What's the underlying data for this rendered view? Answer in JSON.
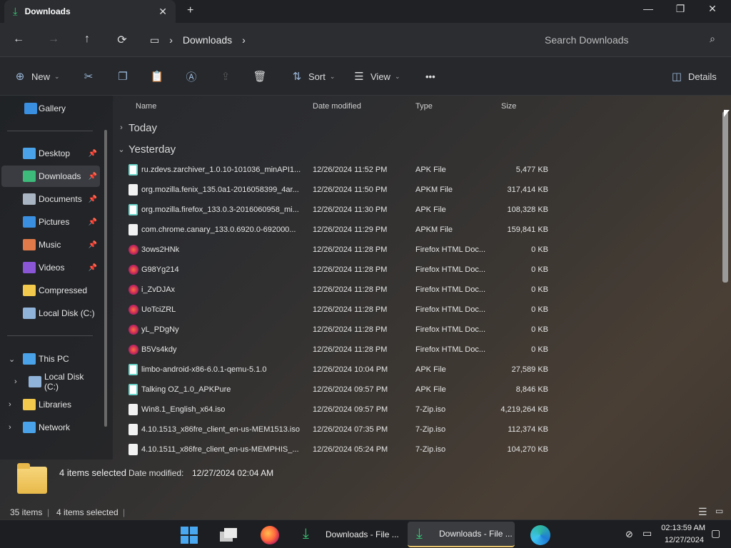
{
  "window": {
    "tab_title": "Downloads",
    "tab_close": "✕",
    "new_tab": "+",
    "controls": {
      "minimize": "—",
      "maximize": "❐",
      "close": "✕"
    }
  },
  "address": {
    "back": "←",
    "forward": "→",
    "up": "↑",
    "refresh": "⟳",
    "crumbs": [
      "Downloads"
    ],
    "search_placeholder": "Search Downloads"
  },
  "toolbar": {
    "new": "New",
    "sort": "Sort",
    "view": "View",
    "more": "•••",
    "details": "Details"
  },
  "sidebar": {
    "gallery": "Gallery",
    "quick": [
      {
        "label": "Desktop",
        "color": "#4aa3e8",
        "pinned": true
      },
      {
        "label": "Downloads",
        "color": "#3dbb7a",
        "pinned": true,
        "selected": true
      },
      {
        "label": "Documents",
        "color": "#a9b4c2",
        "pinned": true
      },
      {
        "label": "Pictures",
        "color": "#3a8fe0",
        "pinned": true
      },
      {
        "label": "Music",
        "color": "#e07a4a",
        "pinned": true
      },
      {
        "label": "Videos",
        "color": "#8b56d6",
        "pinned": true
      },
      {
        "label": "Compressed",
        "color": "#f2c94c",
        "pinned": false
      },
      {
        "label": "Local Disk (C:)",
        "color": "#8fb3d9",
        "pinned": false
      }
    ],
    "tree": [
      {
        "label": "This PC",
        "chev": "⌄"
      },
      {
        "label": "Local Disk (C:)",
        "chev": "›"
      },
      {
        "label": "Libraries",
        "chev": "›"
      },
      {
        "label": "Network",
        "chev": "›"
      }
    ]
  },
  "columns": {
    "name": "Name",
    "date": "Date modified",
    "type": "Type",
    "size": "Size"
  },
  "groups": {
    "today": "Today",
    "yesterday": "Yesterday"
  },
  "files": [
    {
      "name": "ru.zdevs.zarchiver_1.0.10-101036_minAPI1...",
      "date": "12/26/2024 11:52 PM",
      "type": "APK File",
      "size": "5,477 KB",
      "icon": "apk"
    },
    {
      "name": "org.mozilla.fenix_135.0a1-2016058399_4ar...",
      "date": "12/26/2024 11:50 PM",
      "type": "APKM File",
      "size": "317,414 KB",
      "icon": "doc"
    },
    {
      "name": "org.mozilla.firefox_133.0.3-2016060958_mi...",
      "date": "12/26/2024 11:30 PM",
      "type": "APK File",
      "size": "108,328 KB",
      "icon": "apk"
    },
    {
      "name": "com.chrome.canary_133.0.6920.0-692000...",
      "date": "12/26/2024 11:29 PM",
      "type": "APKM File",
      "size": "159,841 KB",
      "icon": "doc"
    },
    {
      "name": "3ows2HNk",
      "date": "12/26/2024 11:28 PM",
      "type": "Firefox HTML Doc...",
      "size": "0 KB",
      "icon": "ff"
    },
    {
      "name": "G98Yg214",
      "date": "12/26/2024 11:28 PM",
      "type": "Firefox HTML Doc...",
      "size": "0 KB",
      "icon": "ff"
    },
    {
      "name": "i_ZvDJAx",
      "date": "12/26/2024 11:28 PM",
      "type": "Firefox HTML Doc...",
      "size": "0 KB",
      "icon": "ff"
    },
    {
      "name": "UoTciZRL",
      "date": "12/26/2024 11:28 PM",
      "type": "Firefox HTML Doc...",
      "size": "0 KB",
      "icon": "ff"
    },
    {
      "name": "yL_PDgNy",
      "date": "12/26/2024 11:28 PM",
      "type": "Firefox HTML Doc...",
      "size": "0 KB",
      "icon": "ff"
    },
    {
      "name": "B5Vs4kdy",
      "date": "12/26/2024 11:28 PM",
      "type": "Firefox HTML Doc...",
      "size": "0 KB",
      "icon": "ff"
    },
    {
      "name": "limbo-android-x86-6.0.1-qemu-5.1.0",
      "date": "12/26/2024 10:04 PM",
      "type": "APK File",
      "size": "27,589 KB",
      "icon": "apk"
    },
    {
      "name": "Talking OZ_1.0_APKPure",
      "date": "12/26/2024 09:57 PM",
      "type": "APK File",
      "size": "8,846 KB",
      "icon": "apk"
    },
    {
      "name": "Win8.1_English_x64.iso",
      "date": "12/26/2024 09:57 PM",
      "type": "7-Zip.iso",
      "size": "4,219,264 KB",
      "icon": "doc"
    },
    {
      "name": "4.10.1513_x86fre_client_en-us-MEM1513.iso",
      "date": "12/26/2024 07:35 PM",
      "type": "7-Zip.iso",
      "size": "112,374 KB",
      "icon": "doc"
    },
    {
      "name": "4.10.1511_x86fre_client_en-us-MEMPHIS_...",
      "date": "12/26/2024 05:24 PM",
      "type": "7-Zip.iso",
      "size": "104,270 KB",
      "icon": "doc"
    }
  ],
  "details_pane": {
    "selection": "4 items selected",
    "date_label": "Date modified:",
    "date_value": "12/27/2024 02:04 AM"
  },
  "status": {
    "items": "35 items",
    "selected": "4 items selected"
  },
  "taskbar": {
    "apps": [
      {
        "label": "Downloads - File ...",
        "active": false
      },
      {
        "label": "Downloads - File ...",
        "active": true
      }
    ],
    "time": "02:13:59 AM",
    "date": "12/27/2024"
  }
}
